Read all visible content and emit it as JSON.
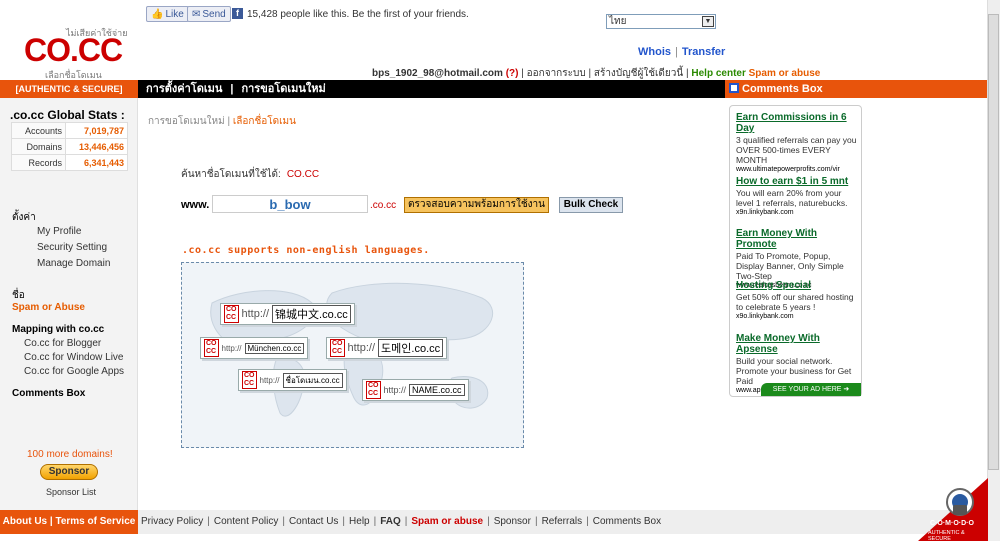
{
  "logo": {
    "tagline": "ไม่เสียค่าใช้จ่าย",
    "text": "CO.CC",
    "sub": "เลือกชื่อโดเมน"
  },
  "social": {
    "like": "Like",
    "send": "Send",
    "fb": "f",
    "text": "15,428 people like this. Be the first of your friends."
  },
  "language": {
    "selected": "ไทย"
  },
  "topnav": {
    "whois": "Whois",
    "sep": "|",
    "transfer": "Transfer"
  },
  "userbar": {
    "email": "bps_1902_98@hotmail.com",
    "help_q": "(?)",
    "logout": "| ออกจากระบบ",
    "create": "| สร้างบัญชีผู้ใช้เดียวนี้ |",
    "help": "Help center",
    "spam": "Spam or abuse"
  },
  "band": {
    "left": "[AUTHENTIC & SECURE]",
    "tab1": "การตั้งค่าโดเมน",
    "sep": "|",
    "tab2": "การขอโดเมนใหม่",
    "comments": "Comments Box"
  },
  "stats": {
    "title": ".co.cc Global Stats :",
    "rows": [
      {
        "label": "Accounts",
        "value": "7,019,787"
      },
      {
        "label": "Domains",
        "value": "13,446,456"
      },
      {
        "label": "Records",
        "value": "6,341,443"
      }
    ]
  },
  "sidebar": {
    "setting": "ตั้งค่า",
    "profile": "My Profile",
    "security": "Security Setting",
    "manage": "Manage Domain",
    "name": "ชื่อ",
    "spam": "Spam or Abuse",
    "mapping": "Mapping with co.cc",
    "blogger": "Co.cc for Blogger",
    "wlive": "Co.cc for Window Live",
    "gapps": "Co.cc for Google Apps",
    "comments": "Comments Box",
    "more": "100 more domains!",
    "sponsor": "Sponsor",
    "sponsor_list": "Sponsor List"
  },
  "main": {
    "crumb1": "การขอโดเมนใหม่",
    "crumb_sep": "|",
    "crumb2": "เลือกชื่อโดเมน",
    "search_title": "ค้นหาชื่อโดเมนที่ใช้ได้:",
    "search_brand": "CO.CC",
    "www": "www.",
    "input_value": "b_bow",
    "tld": ".co.cc",
    "check": "ตรวจสอบความพร้อมการใช้งาน",
    "bulk": "Bulk Check",
    "lang_note": ".co.cc supports non-english languages."
  },
  "chips": [
    {
      "prefix": "http://",
      "domain": "锦城中文.co.cc"
    },
    {
      "prefix": "http://",
      "domain": "München.co.cc"
    },
    {
      "prefix": "http://",
      "domain": "도메인.co.cc"
    },
    {
      "prefix": "http://",
      "domain": "ชื่อโดเมน.co.cc"
    },
    {
      "prefix": "http://",
      "domain": "NAME.co.cc"
    }
  ],
  "ads": [
    {
      "title": "Earn Commissions in 6 Day",
      "body": "3 qualified referrals can pay you OVER 500-times EVERY MONTH",
      "url": "www.ultimatepowerprofits.com/vir"
    },
    {
      "title": "How to earn $1 in 5 mnt",
      "body": "You will earn 20% from your level 1 referrals, naturebucks.",
      "url": "x9n.linkybank.com"
    },
    {
      "title": "Earn Money With Promote",
      "body": "Paid To Promote, Popup, Display Banner, Only Simple Two-Step",
      "url": "www.realcashearn.co.cc"
    },
    {
      "title": "Hosting Special",
      "body": "Get 50% off our shared hosting to celebrate 5 years !",
      "url": "x9o.linkybank.com"
    },
    {
      "title": "Make Money With Apsense",
      "body": "Build your social network. Promote your business for Get Paid",
      "url": "www.apsense.co.cc"
    }
  ],
  "see_ad": "SEE YOUR AD HERE ➜",
  "footer": {
    "left": "About Us | Terms of Service",
    "links": [
      "Privacy Policy",
      "Content Policy",
      "Contact Us",
      "Help",
      "FAQ",
      "Spam or abuse",
      "Sponsor",
      "Referrals",
      "Comments Box"
    ]
  },
  "comodo": {
    "text": "C·O·M·O·D·O",
    "sub": "AUTHENTIC & SECURE"
  },
  "colors": {
    "accent": "#e8540c",
    "brand": "#cc0000",
    "link": "#2255cc",
    "ad_title": "#0a6a2a"
  }
}
